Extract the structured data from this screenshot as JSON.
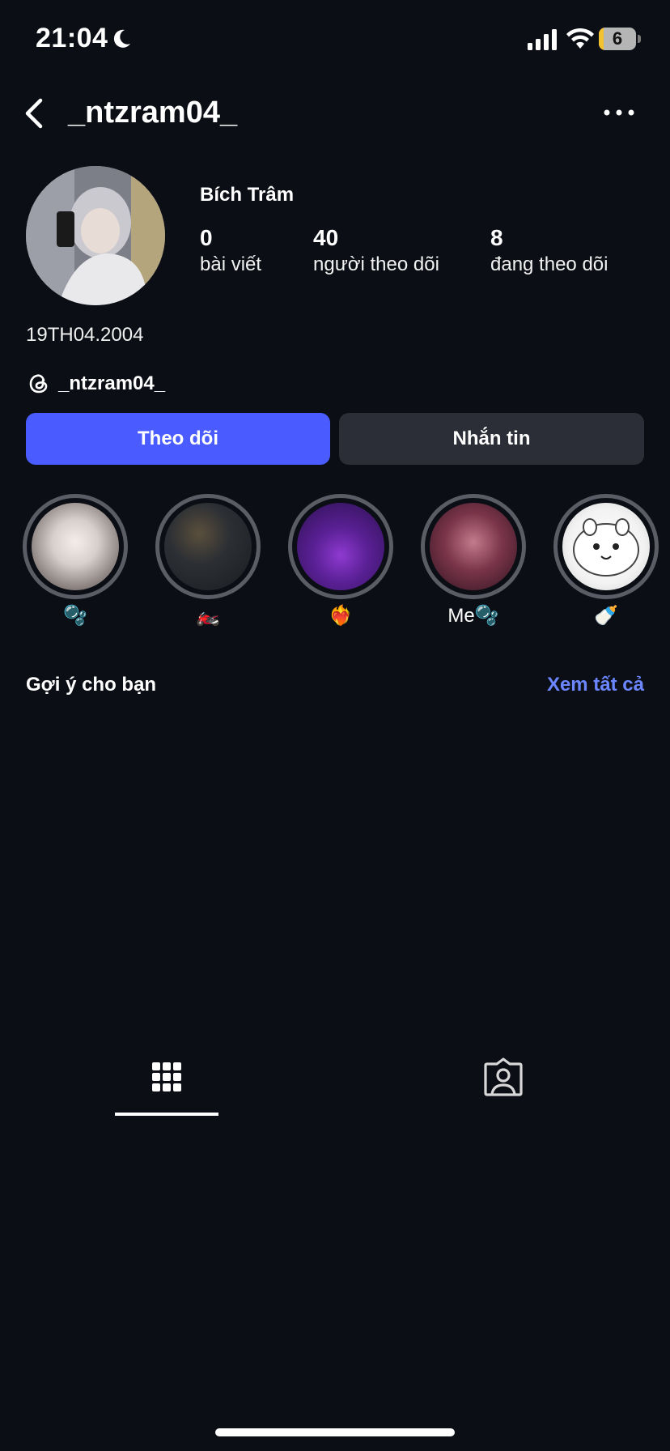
{
  "status_bar": {
    "time": "21:04",
    "battery_level": "6",
    "battery_percent": 6,
    "icons": [
      "moon-icon",
      "signal-icon",
      "wifi-icon",
      "battery-icon"
    ]
  },
  "header": {
    "username": "_ntzram04_",
    "back_icon": "chevron-left-icon",
    "more_icon": "more-horizontal-icon"
  },
  "profile": {
    "display_name": "Bích Trâm",
    "stats": [
      {
        "value": "0",
        "label": "bài viết"
      },
      {
        "value": "40",
        "label": "người theo dõi"
      },
      {
        "value": "8",
        "label": "đang theo dõi"
      }
    ],
    "bio": "19TH04.2004",
    "threads_handle": "_ntzram04_"
  },
  "actions": {
    "follow_label": "Theo dõi",
    "message_label": "Nhắn tin"
  },
  "highlights": [
    {
      "label": "🫧"
    },
    {
      "label": "🏍️"
    },
    {
      "label": "❤️‍🔥"
    },
    {
      "label": "Me🫧"
    },
    {
      "label": "🍼"
    }
  ],
  "suggested": {
    "title": "Gợi ý cho bạn",
    "see_all": "Xem tất cả"
  },
  "tabs": [
    {
      "icon": "grid-icon",
      "active": true
    },
    {
      "icon": "tagged-person-icon",
      "active": false
    }
  ],
  "colors": {
    "background": "#0b0e14",
    "accent": "#4a5cff",
    "link": "#6b86ff",
    "secondary_button": "#2b2e36"
  }
}
